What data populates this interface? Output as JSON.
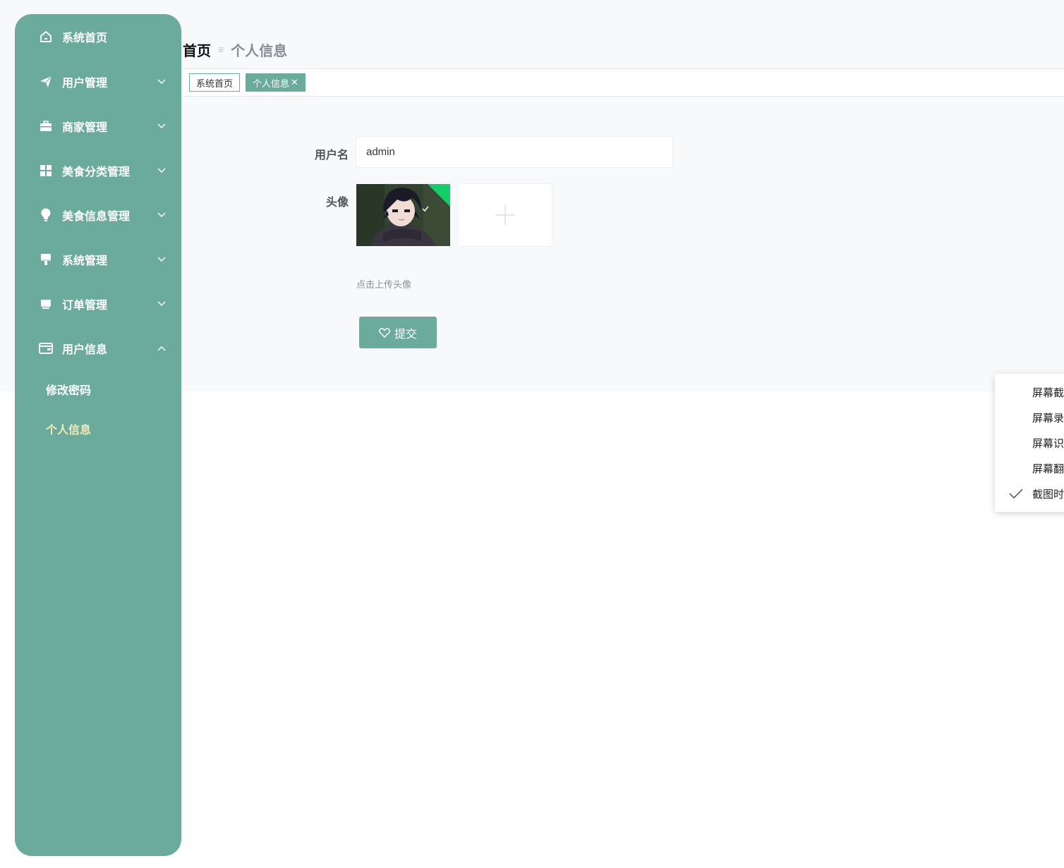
{
  "sidebar": {
    "items": [
      {
        "label": "系统首页",
        "icon": "home-icon"
      },
      {
        "label": "用户管理",
        "icon": "paper-plane-icon"
      },
      {
        "label": "商家管理",
        "icon": "briefcase-icon"
      },
      {
        "label": "美食分类管理",
        "icon": "grid-icon"
      },
      {
        "label": "美食信息管理",
        "icon": "bulb-icon"
      },
      {
        "label": "系统管理",
        "icon": "brush-icon"
      },
      {
        "label": "订单管理",
        "icon": "cart-icon"
      },
      {
        "label": "用户信息",
        "icon": "wallet-icon"
      }
    ],
    "subitems": [
      {
        "label": "修改密码",
        "active": false
      },
      {
        "label": "个人信息",
        "active": true
      }
    ]
  },
  "breadcrumb": {
    "home": "首页",
    "separator": "≡",
    "current": "个人信息"
  },
  "tabs": [
    {
      "label": "系统首页",
      "active": false
    },
    {
      "label": "个人信息",
      "active": true,
      "close": "✕"
    }
  ],
  "form": {
    "username_label": "用户名",
    "username_value": "admin",
    "avatar_label": "头像",
    "upload_hint": "点击上传头像",
    "submit_label": "提交"
  },
  "context_menu": {
    "items": [
      {
        "label": "屏幕截",
        "checked": false
      },
      {
        "label": "屏幕录",
        "checked": false
      },
      {
        "label": "屏幕识",
        "checked": false
      },
      {
        "label": "屏幕翻",
        "checked": false
      },
      {
        "label": "截图时",
        "checked": true
      }
    ]
  },
  "colors": {
    "accent": "#6aab9b",
    "active_sub": "#f6e9b9",
    "upload_success": "#13ce66"
  }
}
